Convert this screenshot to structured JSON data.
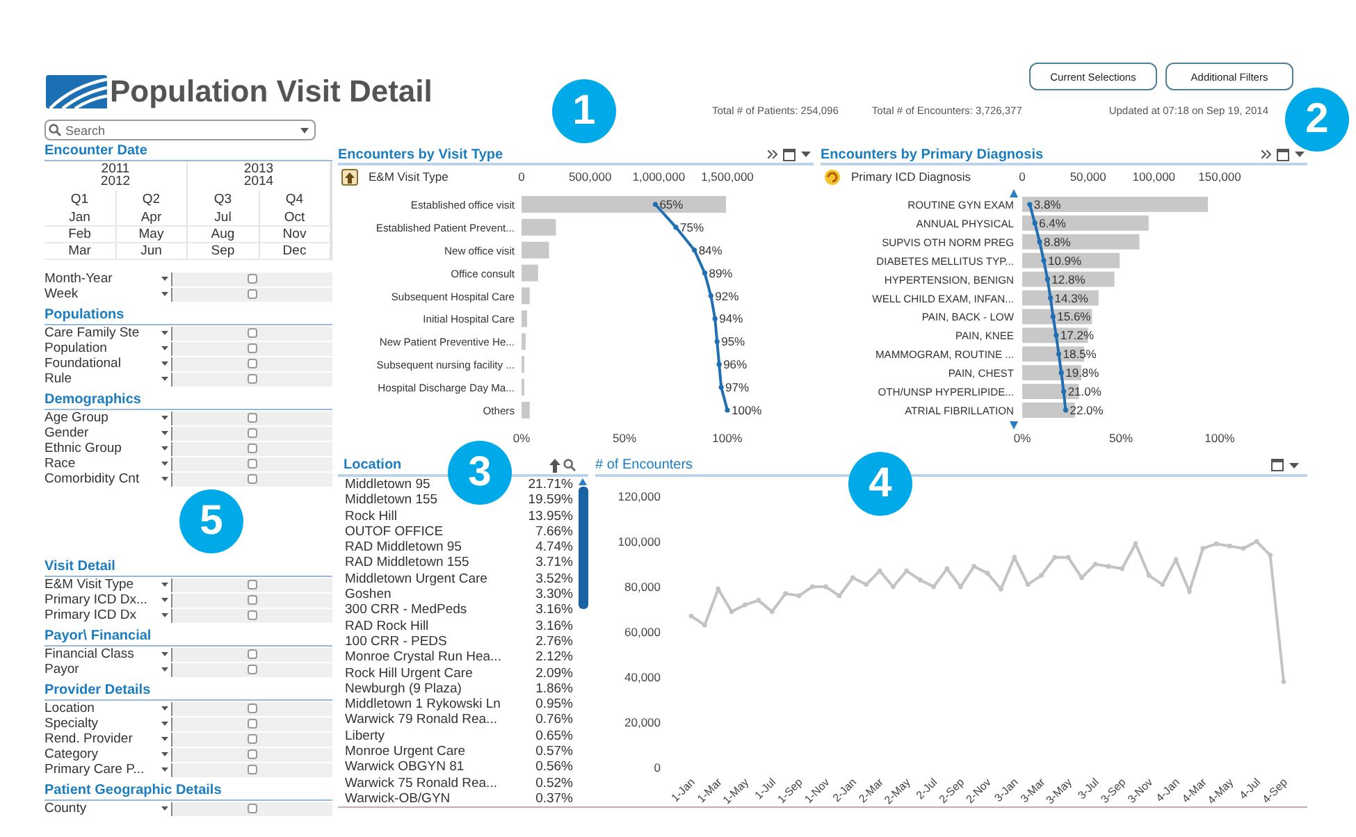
{
  "header": {
    "title": "Population Visit Detail",
    "buttons": [
      {
        "label": "Current Selections"
      },
      {
        "label": "Additional Filters"
      }
    ],
    "stats": [
      "Total # of Patients: 254,096",
      "Total # of Encounters: 3,726,377"
    ],
    "updated": "Updated at 07:18 on Sep 19, 2014",
    "callout": "2"
  },
  "filters": {
    "search": {
      "placeholder": "Search"
    },
    "callout": "5",
    "date": {
      "title": "Encounter Date",
      "years": [
        [
          "2011",
          "2012"
        ],
        [
          "2013",
          "2014"
        ]
      ],
      "quarters": [
        "Q1",
        "Q2",
        "Q3",
        "Q4"
      ],
      "months": [
        "Jan",
        "Apr",
        "Jul",
        "Oct",
        "Feb",
        "May",
        "Aug",
        "Nov",
        "Mar",
        "Jun",
        "Sep",
        "Dec"
      ]
    },
    "groups": [
      {
        "items": [
          {
            "label": "Month-Year",
            "checked": false
          },
          {
            "label": "Week",
            "checked": false
          }
        ]
      },
      {
        "title": "Populations",
        "items": [
          {
            "label": "Care Family Ste",
            "checked": false
          },
          {
            "label": "Population",
            "checked": false
          },
          {
            "label": "Foundational",
            "checked": false
          },
          {
            "label": "Rule",
            "checked": false
          }
        ]
      },
      {
        "title": "Demographics",
        "items": [
          {
            "label": "Age Group",
            "checked": false
          },
          {
            "label": "Gender",
            "checked": false
          },
          {
            "label": "Ethnic Group",
            "checked": false
          },
          {
            "label": "Race",
            "checked": false
          },
          {
            "label": "Comorbidity Cnt",
            "checked": false
          }
        ]
      },
      {
        "title": "Visit Detail",
        "items": [
          {
            "label": "E&M Visit Type",
            "checked": false
          },
          {
            "label": "Primary ICD Dx...",
            "checked": false
          },
          {
            "label": "Primary ICD Dx",
            "checked": false
          }
        ]
      },
      {
        "title": "Payor\\ Financial",
        "items": [
          {
            "label": "Financial Class",
            "checked": false
          },
          {
            "label": "Payor",
            "checked": false
          }
        ]
      },
      {
        "title": "Provider Details",
        "items": [
          {
            "label": "Location",
            "checked": false
          },
          {
            "label": "Specialty",
            "checked": false
          },
          {
            "label": "Rend. Provider",
            "checked": false
          },
          {
            "label": "Category",
            "checked": false
          },
          {
            "label": "Primary Care P...",
            "checked": false
          }
        ]
      },
      {
        "title": "Patient Geographic Details",
        "items": [
          {
            "label": "County",
            "checked": false
          }
        ]
      }
    ]
  },
  "visit_type_chart": {
    "title": "Encounters by Visit Type",
    "dimension": "E&M Visit Type",
    "scrollable": false,
    "callout": "1",
    "chart_data": {
      "type": "bar",
      "orientation": "horizontal",
      "categories": [
        "Established office visit",
        "Established Patient Prevent...",
        "New office visit",
        "Office consult",
        "Subsequent Hospital Care",
        "Initial Hospital Care",
        "New Patient Preventive He...",
        "Subsequent nursing facility ...",
        "Hospital Discharge Day Ma...",
        "Others"
      ],
      "series": [
        {
          "color": "#c8c8c8",
          "values": [
            1490000,
            250000,
            200000,
            120000,
            60000,
            40000,
            30000,
            20000,
            20000,
            60000
          ]
        }
      ],
      "xlim": [
        0,
        1500000
      ],
      "xticks": [
        {
          "value": 0,
          "label": "0"
        },
        {
          "value": 500000,
          "label": "500,000"
        },
        {
          "value": 1000000,
          "label": "1,000,000"
        },
        {
          "value": 1500000,
          "label": "1,500,000"
        }
      ]
    },
    "cumulative": {
      "chart_data": {
        "type": "line",
        "orientation": "horizontal",
        "series": [
          {
            "color": "#1f6fb2",
            "marker": "circle",
            "values": [
              0.65,
              0.75,
              0.84,
              0.89,
              0.92,
              0.94,
              0.95,
              0.96,
              0.97,
              1.0
            ]
          }
        ],
        "xlim": [
          0,
          1
        ],
        "xticks": [
          {
            "value": 0,
            "label": "0%"
          },
          {
            "value": 0.5,
            "label": "50%"
          },
          {
            "value": 1,
            "label": "100%"
          }
        ],
        "value_labels": [
          "65%",
          "75%",
          "84%",
          "89%",
          "92%",
          "94%",
          "95%",
          "96%",
          "97%",
          "100%"
        ]
      }
    }
  },
  "diagnosis_chart": {
    "title": "Encounters by Primary Diagnosis",
    "dimension": "Primary ICD Diagnosis",
    "scrollable": true,
    "chart_data": {
      "type": "bar",
      "orientation": "horizontal",
      "categories": [
        "ROUTINE GYN EXAM",
        "ANNUAL PHYSICAL",
        "SUPVIS OTH NORM PREG",
        "DIABETES MELLITUS TYP...",
        "HYPERTENSION, BENIGN",
        "WELL CHILD EXAM, INFAN...",
        "PAIN, BACK - LOW",
        "PAIN, KNEE",
        "MAMMOGRAM, ROUTINE ...",
        "PAIN, CHEST",
        "OTH/UNSP HYPERLIPIDE...",
        "ATRIAL FIBRILLATION"
      ],
      "series": [
        {
          "color": "#c8c8c8",
          "values": [
            141000,
            96000,
            89000,
            74000,
            70000,
            58000,
            53000,
            50000,
            47000,
            45000,
            43000,
            40000
          ]
        }
      ],
      "xlim": [
        0,
        150000
      ],
      "xticks": [
        {
          "value": 0,
          "label": "0"
        },
        {
          "value": 50000,
          "label": "50,000"
        },
        {
          "value": 100000,
          "label": "100,000"
        },
        {
          "value": 150000,
          "label": "150,000"
        }
      ]
    },
    "cumulative": {
      "chart_data": {
        "type": "line",
        "orientation": "horizontal",
        "series": [
          {
            "color": "#1f6fb2",
            "marker": "circle",
            "values": [
              0.038,
              0.064,
              0.088,
              0.109,
              0.128,
              0.143,
              0.156,
              0.172,
              0.185,
              0.198,
              0.21,
              0.22
            ]
          }
        ],
        "xlim": [
          0,
          1
        ],
        "xticks": [
          {
            "value": 0,
            "label": "0%"
          },
          {
            "value": 0.5,
            "label": "50%"
          },
          {
            "value": 1,
            "label": "100%"
          }
        ],
        "value_labels": [
          "3.8%",
          "6.4%",
          "8.8%",
          "10.9%",
          "12.8%",
          "14.3%",
          "15.6%",
          "17.2%",
          "18.5%",
          "19.8%",
          "21.0%",
          "22.0%"
        ]
      }
    }
  },
  "location_list": {
    "title": "Location",
    "callout": "3",
    "rows": [
      {
        "name": "Middletown 95",
        "share": "21.71%"
      },
      {
        "name": "Middletown 155",
        "share": "19.59%"
      },
      {
        "name": "Rock Hill",
        "share": "13.95%"
      },
      {
        "name": "OUTOF OFFICE",
        "share": "7.66%"
      },
      {
        "name": "RAD Middletown 95",
        "share": "4.74%"
      },
      {
        "name": "RAD Middletown 155",
        "share": "3.71%"
      },
      {
        "name": "Middletown Urgent Care",
        "share": "3.52%"
      },
      {
        "name": "Goshen",
        "share": "3.30%"
      },
      {
        "name": "300 CRR - MedPeds",
        "share": "3.16%"
      },
      {
        "name": "RAD Rock Hill",
        "share": "3.16%"
      },
      {
        "name": "100 CRR - PEDS",
        "share": "2.76%"
      },
      {
        "name": "Monroe Crystal Run Hea...",
        "share": "2.12%"
      },
      {
        "name": "Rock Hill Urgent Care",
        "share": "2.09%"
      },
      {
        "name": "Newburgh (9 Plaza)",
        "share": "1.86%"
      },
      {
        "name": "Middletown 1 Rykowski Ln",
        "share": "0.95%"
      },
      {
        "name": "Warwick 79 Ronald Rea...",
        "share": "0.76%"
      },
      {
        "name": "Liberty",
        "share": "0.65%"
      },
      {
        "name": "Monroe Urgent Care",
        "share": "0.57%"
      },
      {
        "name": "Warwick OBGYN 81",
        "share": "0.56%"
      },
      {
        "name": "Warwick 75 Ronald Rea...",
        "share": "0.52%"
      },
      {
        "name": "Warwick-OB/GYN",
        "share": "0.37%"
      }
    ]
  },
  "encounters_chart": {
    "title": "# of Encounters",
    "callout": "4",
    "chart_data": {
      "type": "line",
      "categories": [
        "1-Jan",
        null,
        "1-Mar",
        null,
        "1-May",
        null,
        "1-Jul",
        null,
        "1-Sep",
        null,
        "1-Nov",
        null,
        "2-Jan",
        null,
        "2-Mar",
        null,
        "2-May",
        null,
        "2-Jul",
        null,
        "2-Sep",
        null,
        "2-Nov",
        null,
        "3-Jan",
        null,
        "3-Mar",
        null,
        "3-May",
        null,
        "3-Jul",
        null,
        "3-Sep",
        null,
        "3-Nov",
        null,
        "4-Jan",
        null,
        "4-Mar",
        null,
        "4-May",
        null,
        "4-Jul",
        null,
        "4-Sep"
      ],
      "series": [
        {
          "color": "#c3c3c3",
          "marker": "circle",
          "values": [
            67000,
            63000,
            79000,
            69000,
            72000,
            74000,
            69000,
            77000,
            76000,
            80000,
            80000,
            76000,
            84000,
            81000,
            87000,
            80000,
            87000,
            83000,
            80000,
            88000,
            80000,
            89000,
            86000,
            79000,
            93000,
            81000,
            85000,
            93000,
            93000,
            84000,
            90000,
            89000,
            88000,
            99000,
            85000,
            81000,
            92000,
            78000,
            97000,
            99000,
            98000,
            97000,
            100000,
            94000,
            38000
          ]
        }
      ],
      "ylim": [
        0,
        120000
      ],
      "yticks": [
        {
          "value": 0,
          "label": "0"
        },
        {
          "value": 20000,
          "label": "20,000"
        },
        {
          "value": 40000,
          "label": "40,000"
        },
        {
          "value": 60000,
          "label": "60,000"
        },
        {
          "value": 80000,
          "label": "80,000"
        },
        {
          "value": 100000,
          "label": "100,000"
        },
        {
          "value": 120000,
          "label": "120,000"
        }
      ]
    }
  }
}
